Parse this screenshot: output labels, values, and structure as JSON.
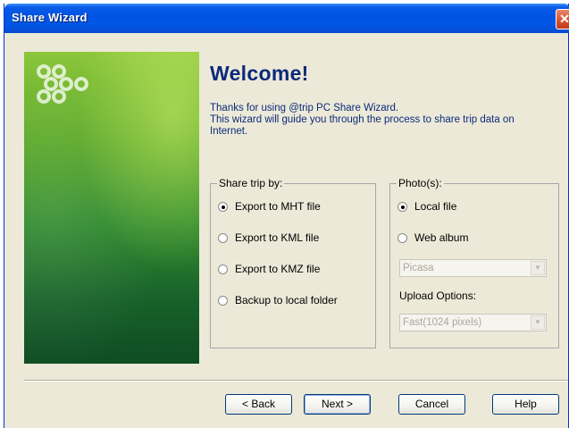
{
  "window": {
    "title": "Share Wizard"
  },
  "welcome": {
    "heading": "Welcome!",
    "lines": [
      "Thanks for using @trip PC Share Wizard.",
      "This wizard will guide you through the process to share trip data on",
      "Internet."
    ]
  },
  "share_trip": {
    "legend": "Share trip by:",
    "options": [
      {
        "label": "Export to MHT file",
        "selected": true
      },
      {
        "label": "Export to KML file",
        "selected": false
      },
      {
        "label": "Export to KMZ file",
        "selected": false
      },
      {
        "label": "Backup to local folder",
        "selected": false
      }
    ]
  },
  "photos": {
    "legend": "Photo(s):",
    "options": [
      {
        "label": "Local file",
        "selected": true
      },
      {
        "label": "Web album",
        "selected": false
      }
    ],
    "album_select": {
      "value": "Picasa",
      "enabled": false
    },
    "upload_label": "Upload Options:",
    "upload_select": {
      "value": "Fast(1024 pixels)",
      "enabled": false
    }
  },
  "buttons": {
    "back": "< Back",
    "next": "Next >",
    "cancel": "Cancel",
    "help": "Help"
  },
  "colors": {
    "titlebar": "#0054e3",
    "dialog_bg": "#ece9d8",
    "heading": "#0c2a7a",
    "banner_top": "#8cc63c",
    "banner_bottom": "#0f4c22"
  },
  "icons": {
    "close": "close-icon",
    "logo": "chain-logo-icon",
    "dropdown": "chevron-down-icon"
  }
}
